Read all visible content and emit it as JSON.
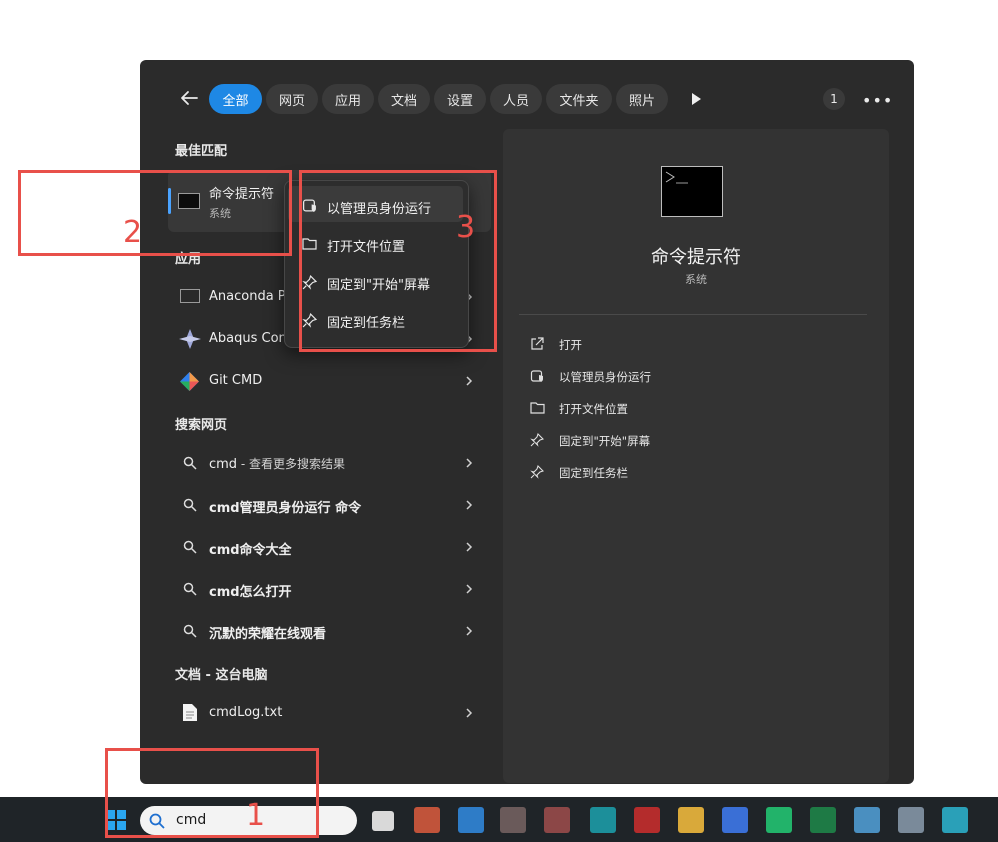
{
  "filters": {
    "back": "←",
    "tabs": [
      "全部",
      "网页",
      "应用",
      "文档",
      "设置",
      "人员",
      "文件夹",
      "照片"
    ],
    "count": "1",
    "more": "•••"
  },
  "best_match": {
    "heading": "最佳匹配",
    "title": "命令提示符",
    "subtitle": "系统"
  },
  "apps": {
    "heading": "应用",
    "items": [
      "Anaconda P",
      "Abaqus Con",
      "Git CMD"
    ]
  },
  "web": {
    "heading": "搜索网页",
    "items": [
      {
        "bold": "cmd",
        "rest": " - 查看更多搜索结果"
      },
      {
        "bold": "cmd管理员身份运行 命令",
        "rest": ""
      },
      {
        "bold": "cmd命令大全",
        "rest": ""
      },
      {
        "bold": "cmd怎么打开",
        "rest": ""
      },
      {
        "bold": "沉默的荣耀在线观看",
        "rest": ""
      }
    ]
  },
  "docs": {
    "heading": "文档 - 这台电脑",
    "items": [
      "cmdLog.txt"
    ]
  },
  "context_menu": {
    "items": [
      "以管理员身份运行",
      "打开文件位置",
      "固定到\"开始\"屏幕",
      "固定到任务栏"
    ]
  },
  "detail": {
    "title": "命令提示符",
    "subtitle": "系统",
    "actions": [
      "打开",
      "以管理员身份运行",
      "打开文件位置",
      "固定到\"开始\"屏幕",
      "固定到任务栏"
    ]
  },
  "annotations": {
    "one": "1",
    "two": "2",
    "three": "3"
  },
  "taskbar": {
    "search_value": "cmd"
  },
  "colors": {
    "accent": "#1e88e5",
    "annotation_red": "#e8504a",
    "panel": "#2b2b2b",
    "detail_pane": "#333333"
  }
}
